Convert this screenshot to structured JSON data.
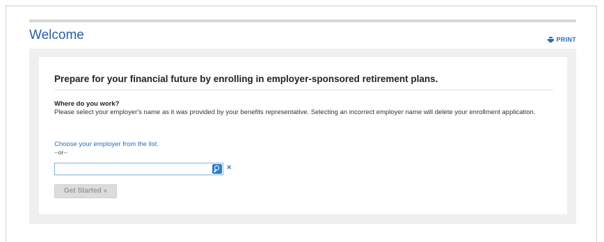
{
  "page": {
    "title": "Welcome",
    "print_label": "PRINT"
  },
  "enrollment": {
    "headline": "Prepare for your financial future by enrolling in employer-sponsored retirement plans.",
    "question": "Where do you work?",
    "instructions": "Please select your employer's name as it was provided by your benefits representative. Selecting an incorrect employer name will delete your enrollment application.",
    "choose_link": "Choose your employer from the list.",
    "or_text": "--or--",
    "search_value": "",
    "clear_symbol": "×",
    "get_started_label": "Get Started »",
    "get_started_disabled": true
  },
  "colors": {
    "title_blue": "#2a5da8",
    "link_blue": "#2a6fb7",
    "search_button_blue": "#2f7fc8",
    "band_gray": "#efefef",
    "disabled_button_gray": "#dcdcdc"
  },
  "icons": [
    "print-icon",
    "search-icon",
    "clear-icon"
  ]
}
